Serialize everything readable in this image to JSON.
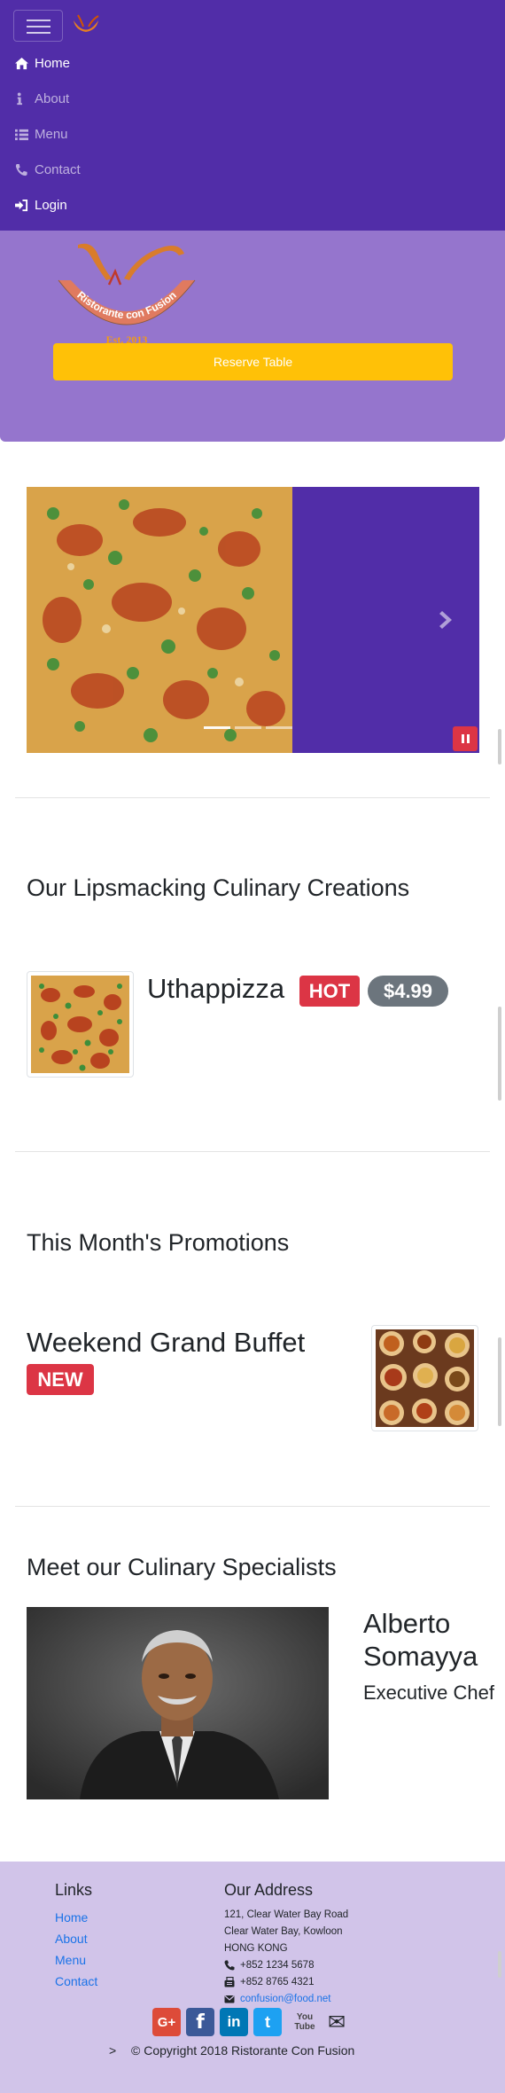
{
  "navbar": {
    "items": [
      {
        "label": "Home",
        "icon": "home-icon",
        "active": true
      },
      {
        "label": "About",
        "icon": "info-icon",
        "active": false
      },
      {
        "label": "Menu",
        "icon": "list-icon",
        "active": false
      },
      {
        "label": "Contact",
        "icon": "phone-icon",
        "active": false
      },
      {
        "label": "Login",
        "icon": "sign-in-icon",
        "active": true
      }
    ]
  },
  "jumbotron": {
    "logo_text": "Ristorante con Fusion",
    "logo_est": "Est. 2013",
    "reserve_label": "Reserve Table"
  },
  "carousel": {
    "slide_count": 3,
    "active_slide": 1
  },
  "dishes": {
    "title": "Our Lipsmacking Culinary Creations",
    "item": {
      "name": "Uthappizza",
      "badge": "HOT",
      "price": "$4.99"
    }
  },
  "promotions": {
    "title": "This Month's Promotions",
    "item": {
      "name": "Weekend Grand Buffet",
      "badge": "NEW"
    }
  },
  "leaders": {
    "title": "Meet our Culinary Specialists",
    "item": {
      "name": "Alberto Somayya",
      "role": "Executive Chef"
    }
  },
  "footer": {
    "links_title": "Links",
    "links": [
      "Home",
      "About",
      "Menu",
      "Contact"
    ],
    "address_title": "Our Address",
    "address": [
      "121, Clear Water Bay Road",
      "Clear Water Bay, Kowloon",
      "HONG KONG"
    ],
    "phone": "+852 1234 5678",
    "fax": "+852 8765 4321",
    "email": "confusion@food.net",
    "arrow": ">",
    "copyright": "© Copyright 2018 Ristorante Con Fusion",
    "social": [
      {
        "name": "google-plus",
        "glyph": "G+",
        "color": "#DD4B39"
      },
      {
        "name": "facebook",
        "glyph": "f",
        "color": "#3B5998"
      },
      {
        "name": "linkedin",
        "glyph": "in",
        "color": "#0077B5"
      },
      {
        "name": "twitter",
        "glyph": "t",
        "color": "#1DA1F2"
      },
      {
        "name": "youtube",
        "glyph": "You Tube",
        "color": "#777777"
      },
      {
        "name": "mail",
        "glyph": "✉",
        "color": "#212529"
      }
    ]
  },
  "colors": {
    "primary": "#512DA8",
    "light": "#9575CD",
    "footer": "#D1C4E9",
    "warning": "#FFC107",
    "danger": "#DC3545"
  }
}
